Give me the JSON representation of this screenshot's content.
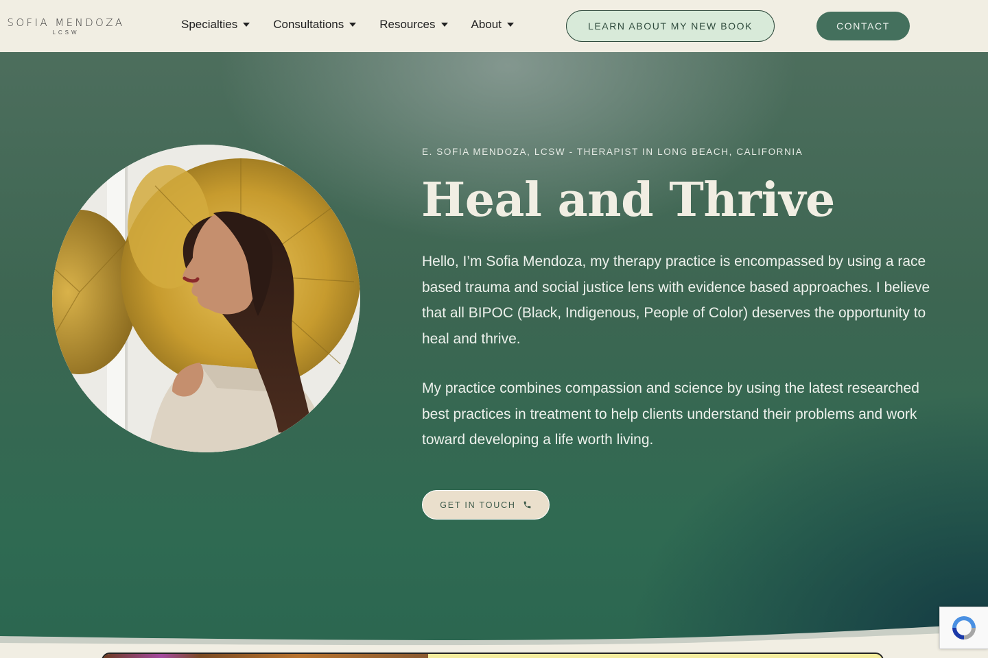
{
  "header": {
    "logo_name": "SOFIA MENDOZA",
    "logo_sub": "LCSW",
    "nav": [
      {
        "label": "Specialties"
      },
      {
        "label": "Consultations"
      },
      {
        "label": "Resources"
      },
      {
        "label": "About"
      }
    ],
    "book_button": "LEARN ABOUT MY NEW BOOK",
    "contact_button": "CONTACT"
  },
  "hero": {
    "eyebrow": "E. SOFIA MENDOZA, LCSW - THERAPIST IN LONG BEACH, CALIFORNIA",
    "title": "Heal and Thrive",
    "paragraph_1": "Hello, I’m Sofia Mendoza, my therapy practice is encompassed by using a race based trauma and social justice lens with evidence based approaches. I believe that all BIPOC (Black, Indigenous, People of Color) deserves the opportunity to heal and thrive.",
    "paragraph_2": "My practice combines compassion and science by using the latest researched best practices in treatment to help clients understand their problems and work toward developing a life worth living.",
    "cta_label": "GET IN TOUCH",
    "cta_icon": "phone-icon"
  },
  "colors": {
    "header_bg": "#f1eee3",
    "hero_green": "#2f6a52",
    "contact_button_bg": "#44705d",
    "book_button_bg": "#d8ead9",
    "cta_bg": "#eadfcc",
    "gold": "#c9a53a"
  }
}
